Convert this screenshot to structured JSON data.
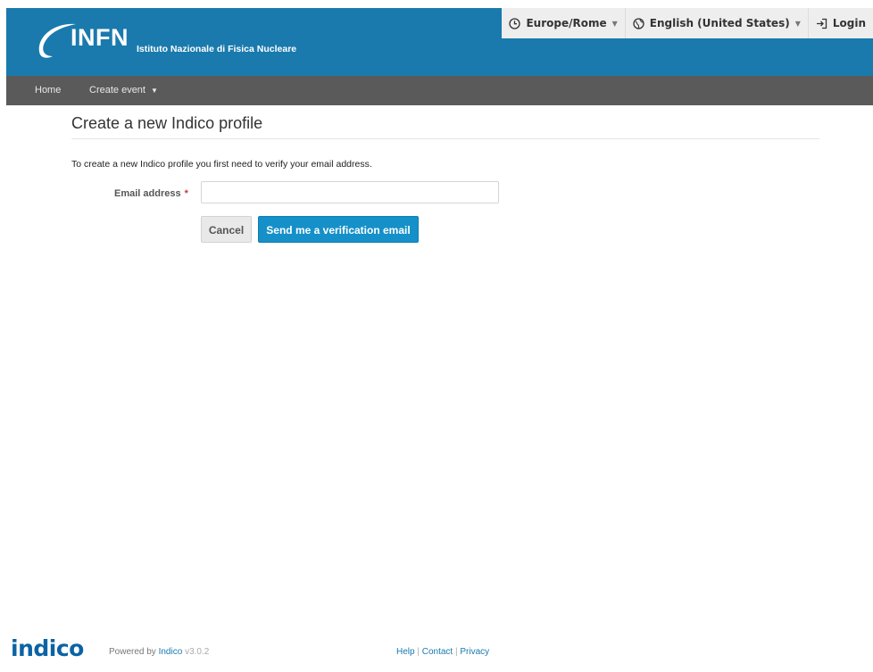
{
  "header": {
    "logo_text": "INFN",
    "org_name": "Istituto Nazionale di Fisica Nucleare",
    "brand_color": "#1a7aad",
    "toolbar": {
      "timezone": "Europe/Rome",
      "language": "English (United States)",
      "login": "Login"
    }
  },
  "nav": {
    "home": "Home",
    "create_event": "Create event"
  },
  "main": {
    "title": "Create a new Indico profile",
    "intro": "To create a new Indico profile you first need to verify your email address.",
    "email_label": "Email address",
    "required_mark": "*",
    "email_value": "",
    "cancel_label": "Cancel",
    "send_label": "Send me a verification email"
  },
  "footer": {
    "logo": "indico",
    "powered_prefix": "Powered by",
    "powered_link": "Indico",
    "version": "v3.0.2",
    "help": "Help",
    "sep": "|",
    "contact": "Contact",
    "privacy": "Privacy"
  }
}
